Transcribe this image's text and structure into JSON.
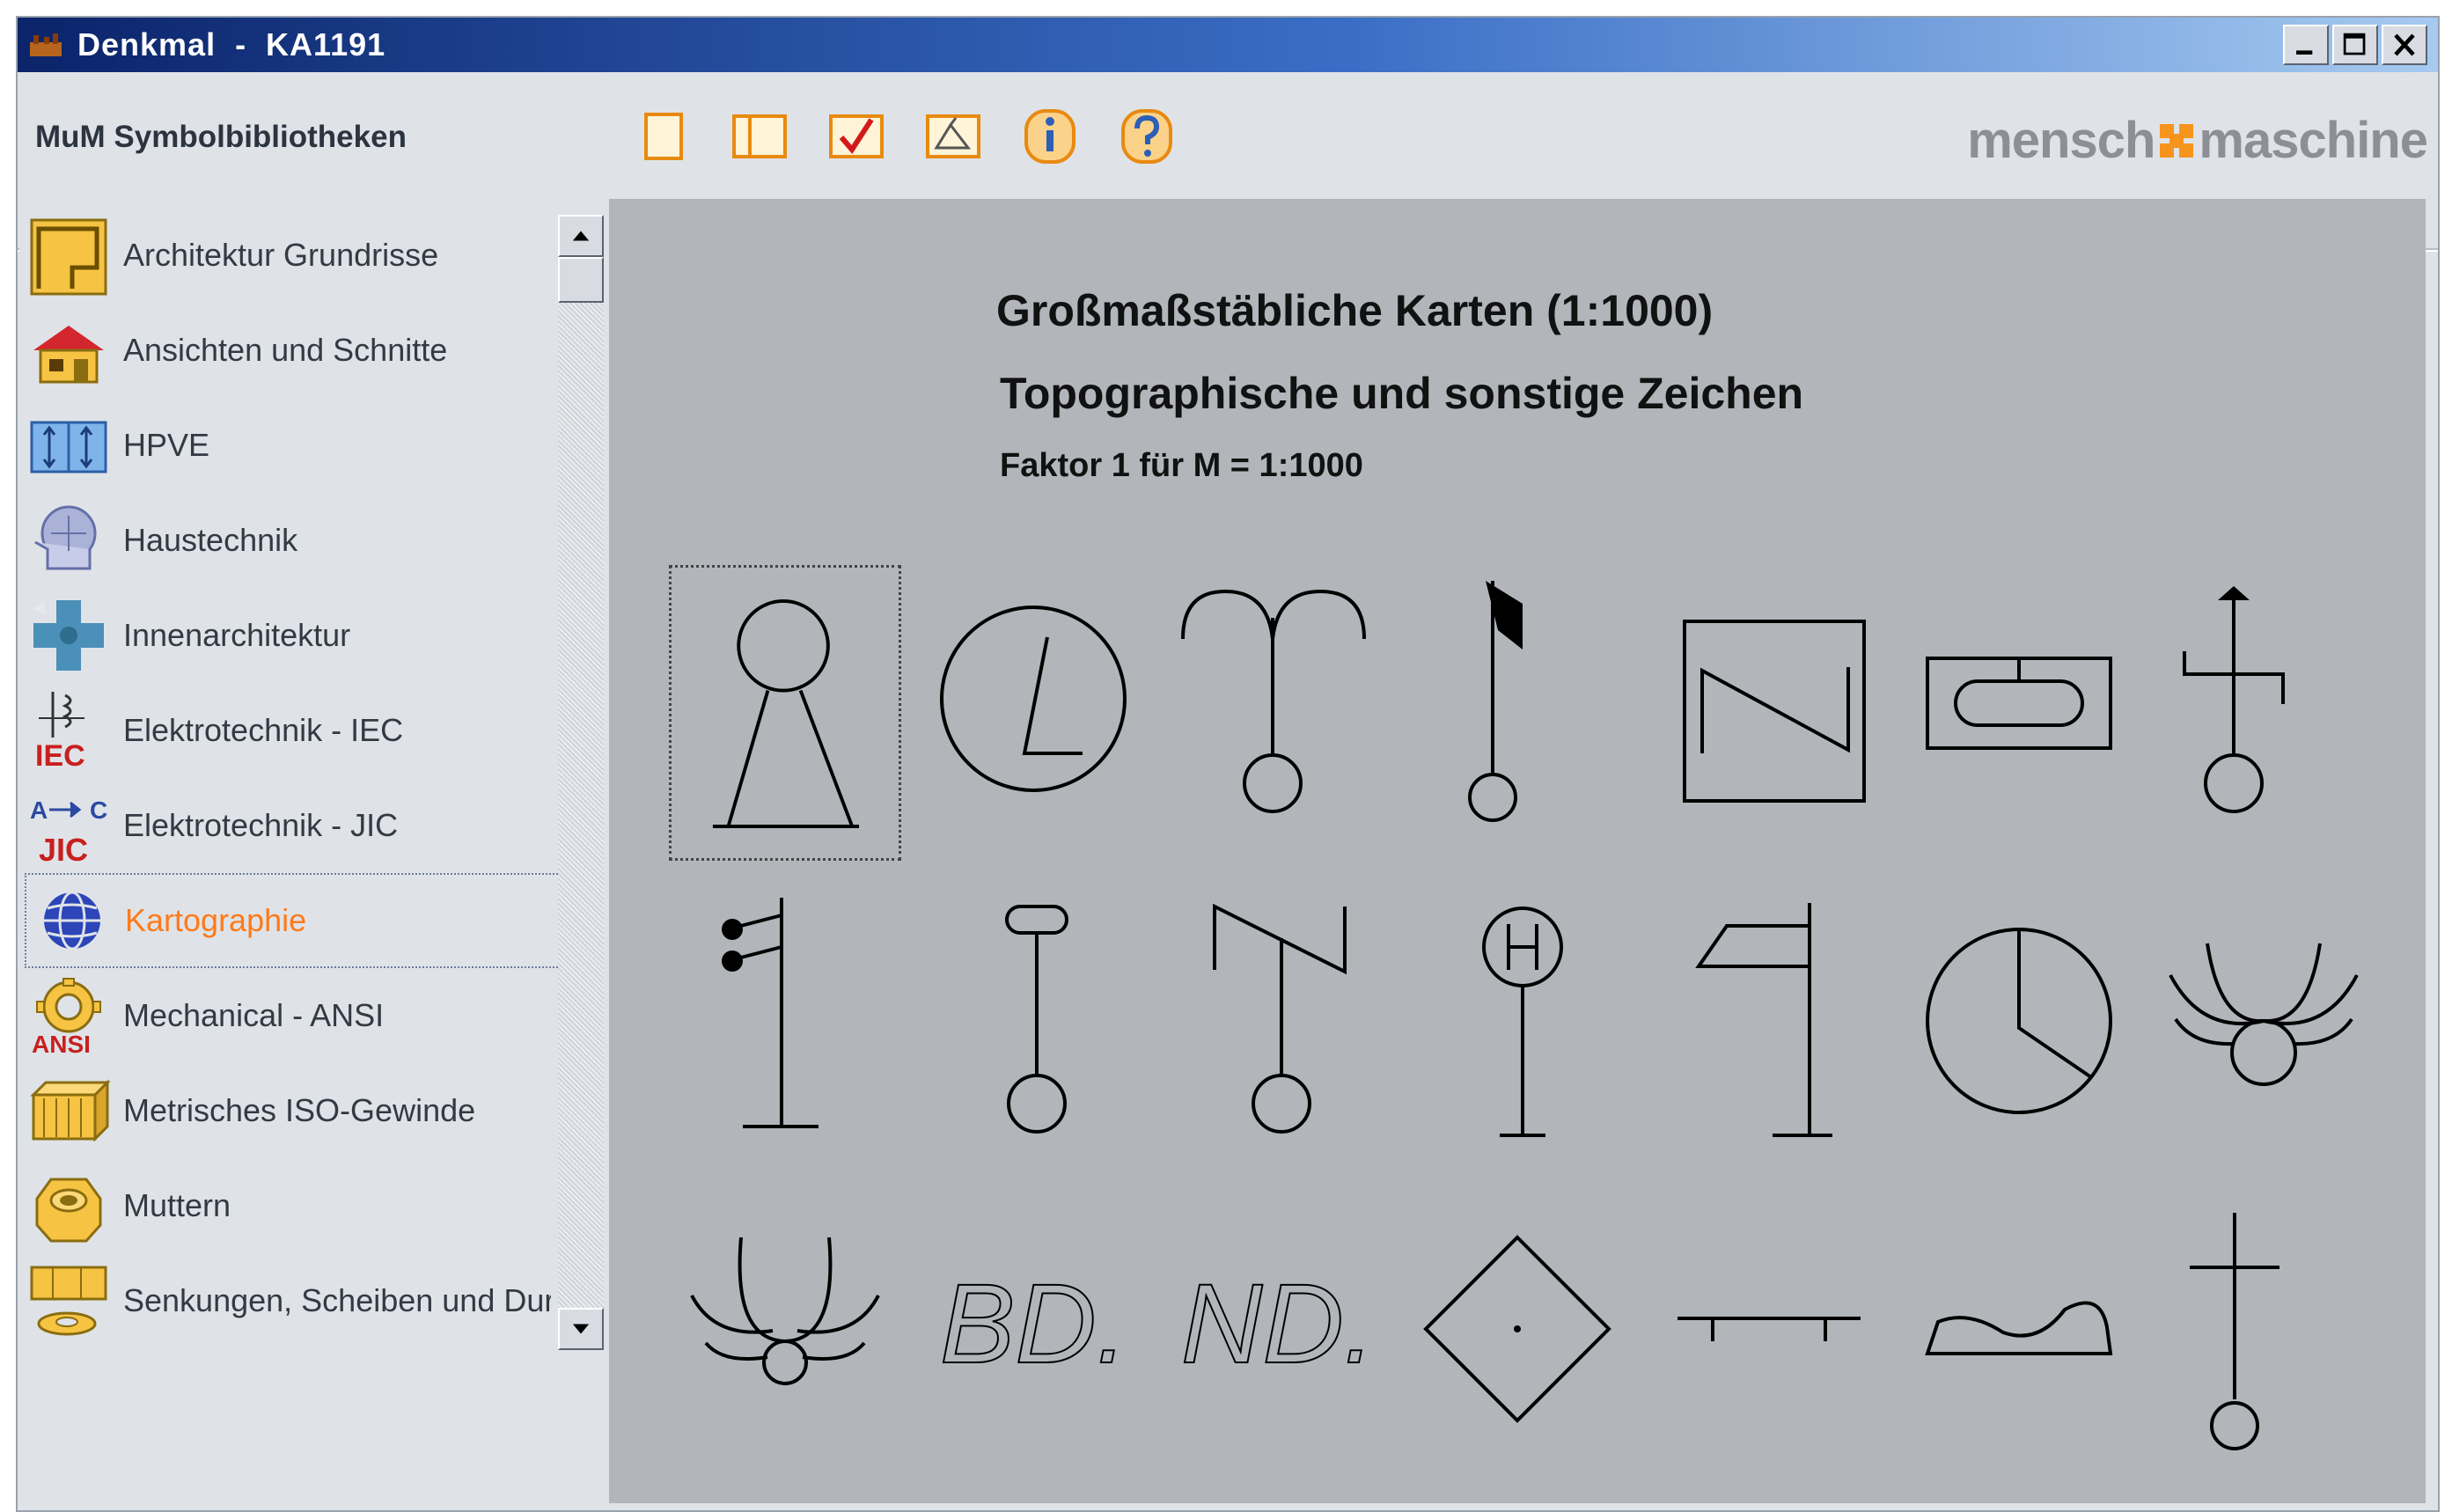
{
  "window": {
    "title": "Denkmal  -  KA1191",
    "controls": [
      "minimize-icon",
      "maximize-icon",
      "close-icon"
    ]
  },
  "toolbar": {
    "library_title": "MuM Symbolbibliotheken",
    "buttons": [
      "new-page-icon",
      "open-book-icon",
      "checklist-icon",
      "insert-block-icon",
      "info-icon",
      "help-icon"
    ],
    "brand_left": "mensch",
    "brand_right": "maschine",
    "accent_color": "#f7941d"
  },
  "sidebar": {
    "items": [
      {
        "label": "Architektur Grundrisse",
        "icon": "floorplan-icon"
      },
      {
        "label": "Ansichten und Schnitte",
        "icon": "house-icon"
      },
      {
        "label": "HPVE",
        "icon": "hpve-icon"
      },
      {
        "label": "Haustechnik",
        "icon": "hvac-icon"
      },
      {
        "label": "Innenarchitektur",
        "icon": "interior-icon"
      },
      {
        "label": "Elektrotechnik - IEC",
        "icon": "iec-icon",
        "badge": "IEC"
      },
      {
        "label": "Elektrotechnik - JIC",
        "icon": "jic-icon",
        "badge": "JIC"
      },
      {
        "label": "Kartographie",
        "icon": "globe-icon",
        "selected": true
      },
      {
        "label": "Mechanical - ANSI",
        "icon": "gear-icon",
        "badge": "ANSI"
      },
      {
        "label": "Metrisches ISO-Gewinde",
        "icon": "thread-icon"
      },
      {
        "label": "Muttern",
        "icon": "nut-icon"
      },
      {
        "label": "Senkungen, Scheiben und Durchgangslöcher",
        "icon": "washer-icon"
      }
    ]
  },
  "main": {
    "heading": "Großmaßstäbliche Karten (1:1000)",
    "subheading": "Topographische und sonstige Zeichen",
    "factor": "Faktor 1 für M = 1:1000",
    "symbols_row3_text": [
      "BD.",
      "ND."
    ]
  }
}
